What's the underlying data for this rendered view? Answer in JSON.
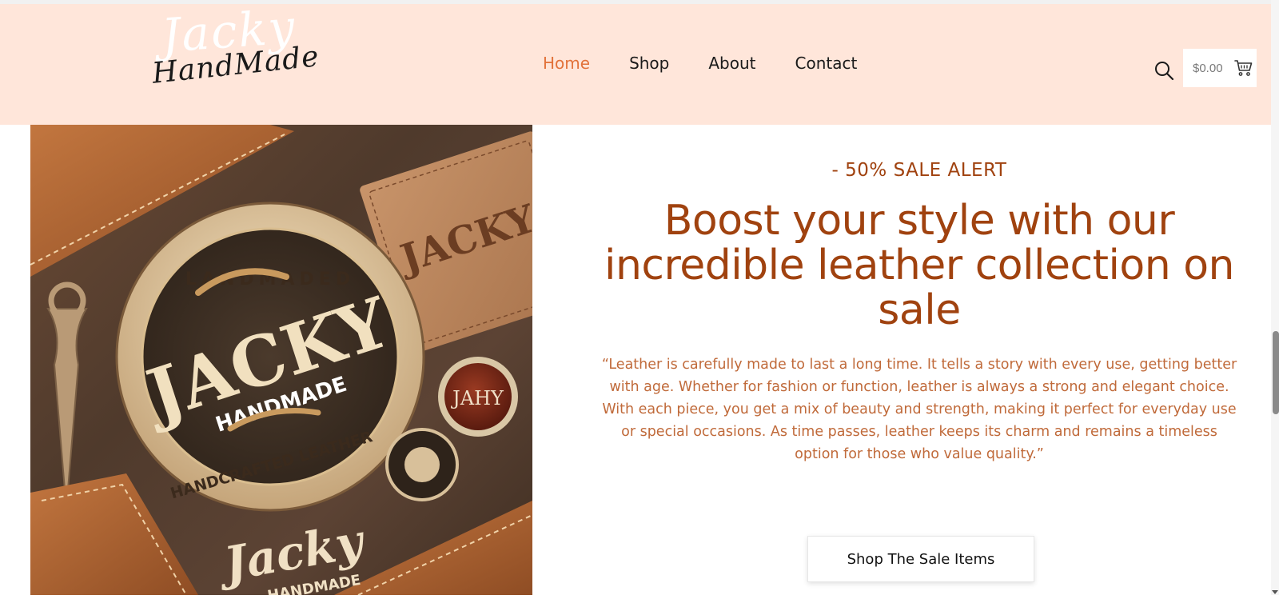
{
  "logo": {
    "line1": "Jacky",
    "line2": "HandMade"
  },
  "nav": {
    "items": [
      {
        "label": "Home",
        "active": true
      },
      {
        "label": "Shop",
        "active": false
      },
      {
        "label": "About",
        "active": false
      },
      {
        "label": "Contact",
        "active": false
      }
    ]
  },
  "header": {
    "search_icon": "search-icon",
    "cart_amount": "$0.00",
    "cart_icon": "cart-icon"
  },
  "hero": {
    "eyebrow": "- 50% SALE ALERT",
    "headline": "Boost your style with our incredible leather collection on sale",
    "quote": "“Leather is carefully made to last a long time. It tells a story with every use, getting better with age. Whether for fashion or function, leather is always a strong and elegant choice. With each piece, you get a mix of beauty and strength, making it perfect for everyday use or special occasions. As time passes, leather keeps its charm and remains a timeless option for those who value quality.”",
    "cta_label": "Shop The Sale Items",
    "image_badge_text": {
      "ring_top": "LANDMADED",
      "center": "JACKY",
      "center_sub": "HANDMADE",
      "ring_bottom": "HANDCRAFTED LEATHER",
      "tag": "JACKY",
      "signature": "Jacky",
      "signature_sub": "HANDMADE"
    }
  },
  "colors": {
    "header_bg": "#ffe6da",
    "accent_orange": "#e2723a",
    "headline_brown": "#a0420f",
    "quote_brown": "#c06a3a"
  }
}
